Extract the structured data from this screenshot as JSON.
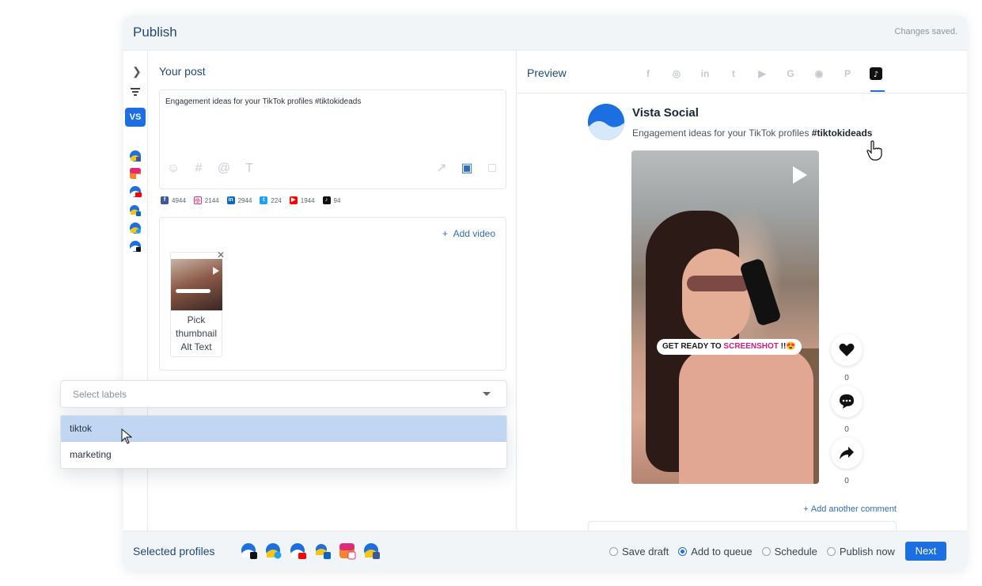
{
  "header": {
    "title": "Publish",
    "status": "Changes saved."
  },
  "rail": {
    "vs_badge": "VS",
    "profile_count": "0"
  },
  "post": {
    "section_title": "Your post",
    "text": "Engagement ideas for your TikTok profiles #tiktokideads",
    "counts": [
      {
        "network": "facebook",
        "value": "4944",
        "color": "#3b5998",
        "glyph": "f"
      },
      {
        "network": "instagram",
        "value": "2144",
        "color": "#e1306c",
        "glyph": "◎"
      },
      {
        "network": "linkedin",
        "value": "2944",
        "color": "#0a66c2",
        "glyph": "in"
      },
      {
        "network": "twitter",
        "value": "224",
        "color": "#1da1f2",
        "glyph": "t"
      },
      {
        "network": "youtube",
        "value": "1944",
        "color": "#ff0000",
        "glyph": "▶"
      },
      {
        "network": "tiktok",
        "value": "94",
        "color": "#111111",
        "glyph": "♪"
      }
    ],
    "add_video": "Add video",
    "thumb_labels": [
      "Pick",
      "thumbnail",
      "Alt Text"
    ]
  },
  "labels": {
    "placeholder": "Select labels",
    "options": [
      "tiktok",
      "marketing"
    ]
  },
  "preview": {
    "section_title": "Preview",
    "tabs": [
      "facebook",
      "instagram",
      "linkedin",
      "twitter",
      "youtube",
      "google",
      "reddit",
      "pinterest",
      "tiktok"
    ],
    "active_tab": "tiktok",
    "profile_name": "Vista Social",
    "caption_text": "Engagement ideas for your TikTok profiles ",
    "caption_tag": "#tiktokideads",
    "video_caption_a": "GET READY TO ",
    "video_caption_b": "SCREENSHOT",
    "video_caption_c": " !!😍",
    "likes": "0",
    "comments": "0",
    "shares": "0",
    "add_comment": "Add another comment"
  },
  "footer": {
    "selected_label": "Selected profiles",
    "options": [
      {
        "label": "Save draft",
        "selected": false
      },
      {
        "label": "Add to queue",
        "selected": true
      },
      {
        "label": "Schedule",
        "selected": false
      },
      {
        "label": "Publish now",
        "selected": false
      }
    ],
    "next": "Next"
  },
  "colors": {
    "accent": "#1b6fe0",
    "title": "#1f4a78",
    "highlight": "#c1d6f3",
    "tiktok_pink": "#d21d7a"
  }
}
